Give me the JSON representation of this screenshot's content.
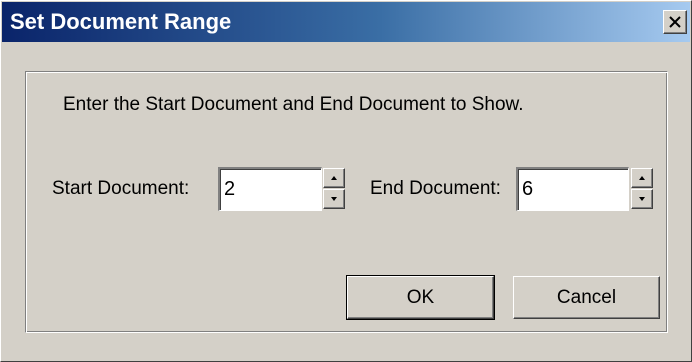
{
  "window": {
    "title": "Set Document Range",
    "close_icon": "close-icon"
  },
  "instruction": "Enter the Start Document and End Document to Show.",
  "start": {
    "label": "Start Document:",
    "value": "2"
  },
  "end": {
    "label": "End Document:",
    "value": "6"
  },
  "buttons": {
    "ok": "OK",
    "cancel": "Cancel"
  },
  "colors": {
    "title_gradient_start": "#0a246a",
    "title_gradient_end": "#a6caf0",
    "face": "#d4d0c8"
  }
}
